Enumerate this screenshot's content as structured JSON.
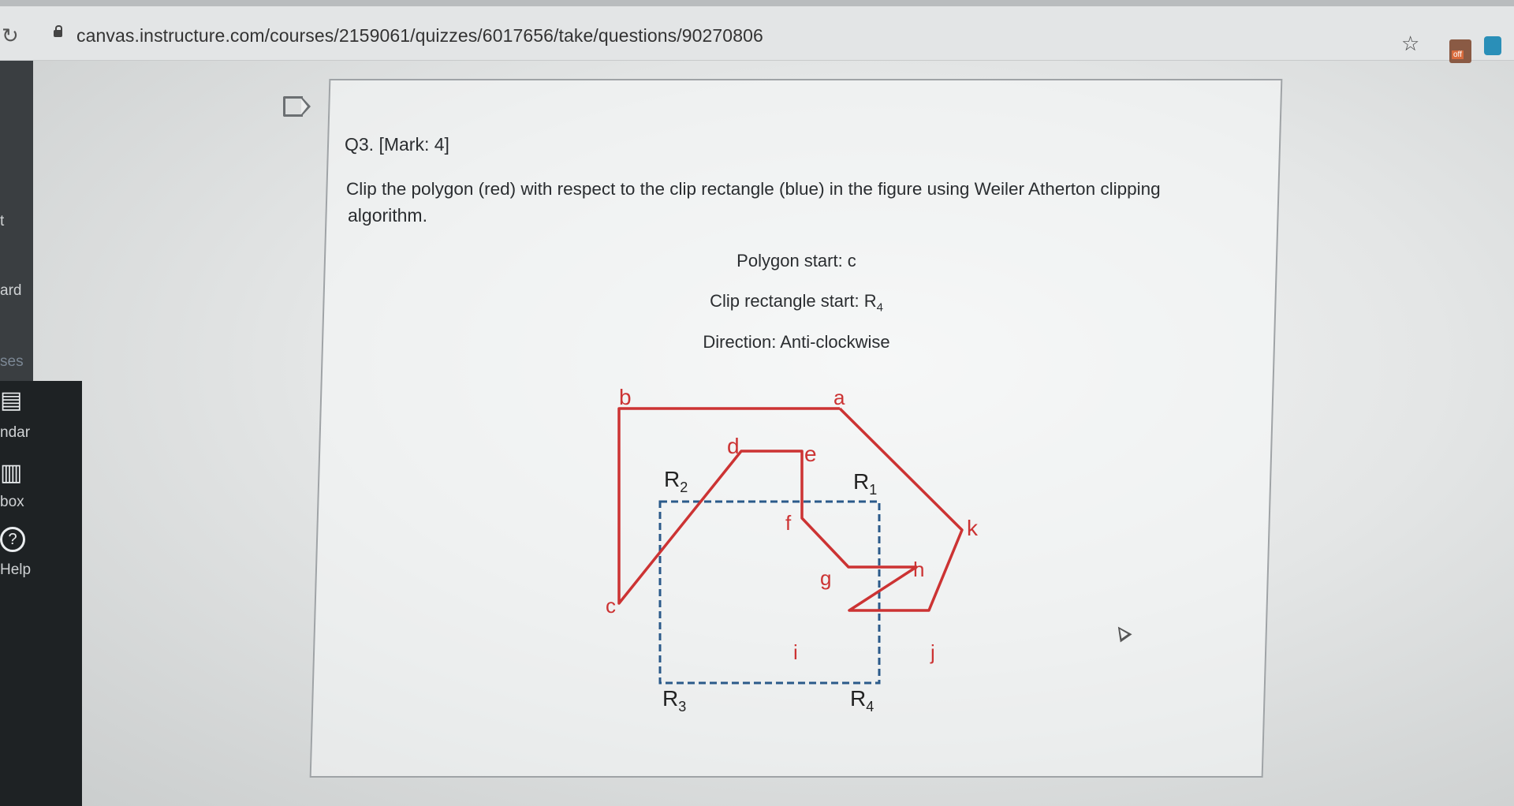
{
  "browser": {
    "url": "canvas.instructure.com/courses/2159061/quizzes/6017656/take/questions/90270806",
    "extension_badge": "off"
  },
  "sidebar": {
    "items": [
      {
        "label": "t"
      },
      {
        "label": "ard"
      },
      {
        "label": "ses"
      },
      {
        "label": "ndar"
      },
      {
        "label": "box"
      },
      {
        "label": "Help"
      }
    ]
  },
  "question": {
    "heading": "Q3. [Mark: 4]",
    "text_line1": "Clip the polygon (red) with respect to the clip rectangle (blue) in the figure using Weiler Atherton clipping",
    "text_line2": "algorithm.",
    "polygon_start": "Polygon start: c",
    "clip_start_prefix": "Clip rectangle start: R",
    "clip_start_sub": "4",
    "direction": "Direction: Anti-clockwise"
  },
  "figure": {
    "polygon_color": "#cc3333",
    "clip_color": "#2b5a8a",
    "vertex_labels": [
      "a",
      "b",
      "c",
      "d",
      "e",
      "f",
      "g",
      "h",
      "i",
      "j",
      "k"
    ],
    "clip_labels": [
      {
        "letter": "R",
        "sub": "1"
      },
      {
        "letter": "R",
        "sub": "2"
      },
      {
        "letter": "R",
        "sub": "3"
      },
      {
        "letter": "R",
        "sub": "4"
      }
    ]
  }
}
